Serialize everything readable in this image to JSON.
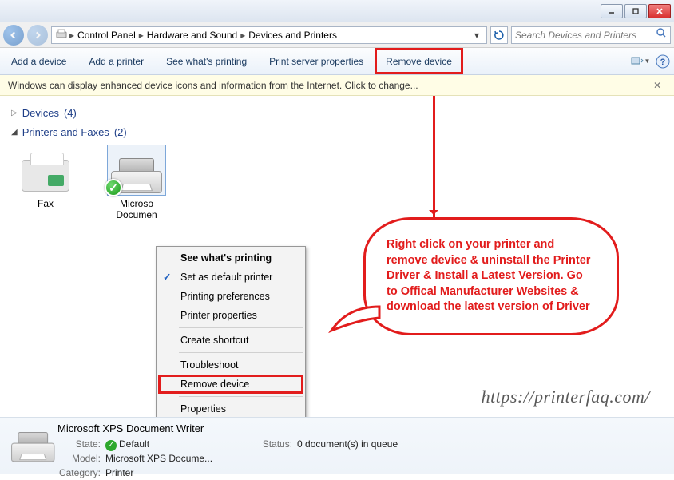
{
  "breadcrumb": {
    "root_icon": "devices-printers",
    "items": [
      "Control Panel",
      "Hardware and Sound",
      "Devices and Printers"
    ]
  },
  "search": {
    "placeholder": "Search Devices and Printers"
  },
  "toolbar": {
    "add_device": "Add a device",
    "add_printer": "Add a printer",
    "see_printing": "See what's printing",
    "server_props": "Print server properties",
    "remove_device": "Remove device"
  },
  "infobar": {
    "text": "Windows can display enhanced device icons and information from the Internet. Click to change..."
  },
  "groups": {
    "devices": {
      "label": "Devices",
      "count": "(4)"
    },
    "printers": {
      "label": "Printers and Faxes",
      "count": "(2)"
    }
  },
  "items": {
    "fax": {
      "label": "Fax"
    },
    "msxps": {
      "label_line1": "Microso",
      "label_line2": "Documen"
    }
  },
  "context_menu": {
    "see_printing": "See what's printing",
    "set_default": "Set as default printer",
    "prefs": "Printing preferences",
    "props": "Printer properties",
    "shortcut": "Create shortcut",
    "troubleshoot": "Troubleshoot",
    "remove": "Remove device",
    "properties": "Properties"
  },
  "callout": {
    "text": "Right click on your printer and remove device & uninstall the Printer Driver & Install a Latest Version. Go to Offical Manufacturer Websites & download the latest version of Driver"
  },
  "watermark": "https://printerfaq.com/",
  "details": {
    "name": "Microsoft XPS Document Writer",
    "state_label": "State:",
    "state_value": "Default",
    "model_label": "Model:",
    "model_value": "Microsoft XPS Docume...",
    "category_label": "Category:",
    "category_value": "Printer",
    "status_label": "Status:",
    "status_value": "0 document(s) in queue"
  }
}
